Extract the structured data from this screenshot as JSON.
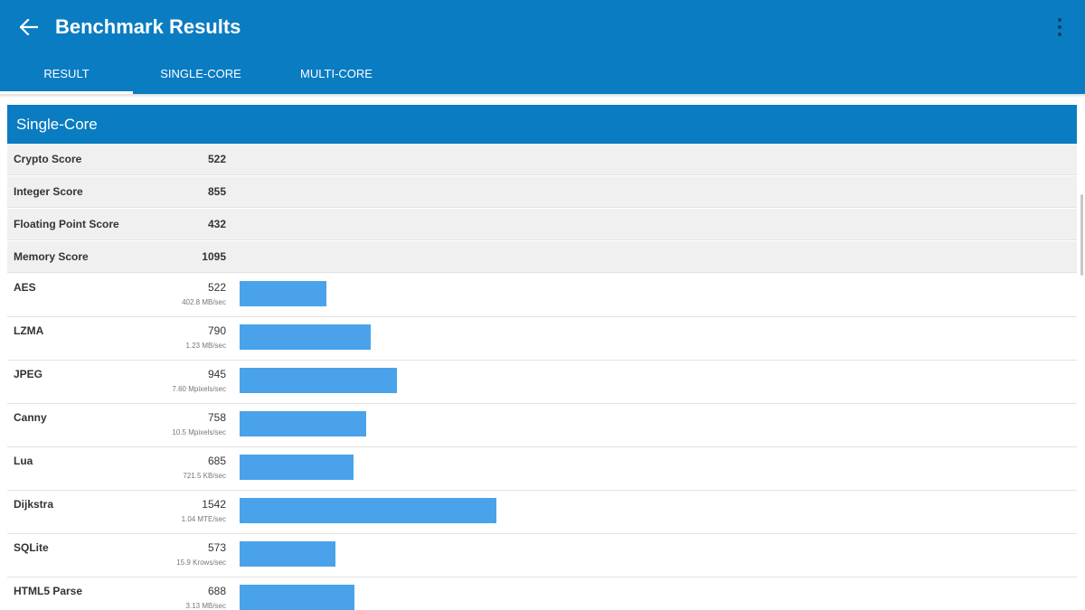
{
  "app_bar": {
    "title": "Benchmark Results",
    "back_icon": "arrow-left-icon",
    "menu_icon": "more-vertical-icon"
  },
  "tabs": [
    {
      "label": "RESULT",
      "selected": true
    },
    {
      "label": "SINGLE-CORE",
      "selected": false
    },
    {
      "label": "MULTI-CORE",
      "selected": false
    }
  ],
  "section": {
    "title": "Single-Core"
  },
  "scores": [
    {
      "label": "Crypto Score",
      "value": "522"
    },
    {
      "label": "Integer Score",
      "value": "855"
    },
    {
      "label": "Floating Point Score",
      "value": "432"
    },
    {
      "label": "Memory Score",
      "value": "1095"
    }
  ],
  "benchmarks": [
    {
      "label": "AES",
      "score": 522,
      "score_text": "522",
      "rate": "402.8 MB/sec"
    },
    {
      "label": "LZMA",
      "score": 790,
      "score_text": "790",
      "rate": "1.23 MB/sec"
    },
    {
      "label": "JPEG",
      "score": 945,
      "score_text": "945",
      "rate": "7.60 Mpixels/sec"
    },
    {
      "label": "Canny",
      "score": 758,
      "score_text": "758",
      "rate": "10.5 Mpixels/sec"
    },
    {
      "label": "Lua",
      "score": 685,
      "score_text": "685",
      "rate": "721.5 KB/sec"
    },
    {
      "label": "Dijkstra",
      "score": 1542,
      "score_text": "1542",
      "rate": "1.04 MTE/sec"
    },
    {
      "label": "SQLite",
      "score": 573,
      "score_text": "573",
      "rate": "15.9 Krows/sec"
    },
    {
      "label": "HTML5 Parse",
      "score": 688,
      "score_text": "688",
      "rate": "3.13 MB/sec"
    }
  ],
  "colors": {
    "app_bar": "#0a7cc2",
    "bar": "#4aa3ea",
    "score_row_bg": "#f0f0f0"
  }
}
